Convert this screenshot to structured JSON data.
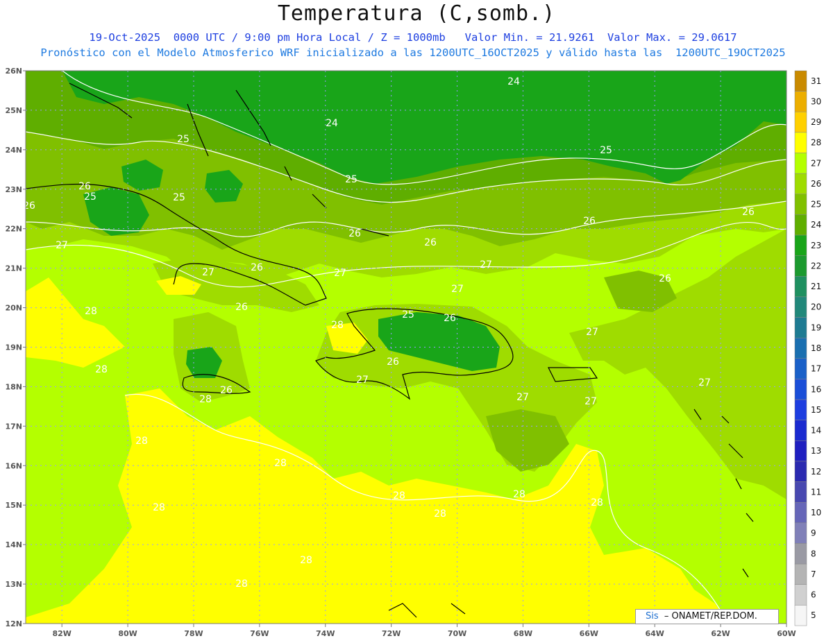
{
  "title": "Temperatura (C,somb.)",
  "subtitle_1": "19-Oct-2025  0000 UTC / 9:00 pm Hora Local / Z = 1000mb   Valor Min. = 21.9261  Valor Max. = 29.0617",
  "subtitle_2": "Pronóstico con el Modelo Atmosferico WRF inicializado a las 1200UTC_16OCT2025 y válido hasta las  1200UTC_19OCT2025",
  "credit": {
    "part1": "Sis",
    "part2": "  – ONAMET/REP.DOM."
  },
  "map": {
    "lon_ticks": [
      "82W",
      "80W",
      "78W",
      "76W",
      "74W",
      "72W",
      "70W",
      "68W",
      "66W",
      "64W",
      "62W",
      "60W"
    ],
    "lat_ticks": [
      "26N",
      "25N",
      "24N",
      "23N",
      "22N",
      "21N",
      "20N",
      "19N",
      "18N",
      "17N",
      "16N",
      "15N",
      "14N",
      "13N",
      "12N"
    ],
    "contour_labels": [
      "24",
      "24",
      "25",
      "25",
      "25",
      "25",
      "25",
      "25",
      "26",
      "26",
      "26",
      "26",
      "26",
      "26",
      "26",
      "26",
      "26",
      "26",
      "26",
      "26",
      "27",
      "27",
      "27",
      "27",
      "27",
      "27",
      "27",
      "27",
      "27",
      "27",
      "28",
      "28",
      "28",
      "28",
      "28",
      "28",
      "28",
      "28",
      "28",
      "28",
      "28",
      "28",
      "28"
    ]
  },
  "colorbar": {
    "levels": [
      "31",
      "30",
      "29",
      "28",
      "27",
      "26",
      "25",
      "24",
      "23",
      "22",
      "21",
      "20",
      "19",
      "18",
      "17",
      "16",
      "15",
      "14",
      "13",
      "12",
      "11",
      "10",
      "9",
      "8",
      "7",
      "6",
      "5"
    ],
    "colors": [
      "#c98a00",
      "#ecae00",
      "#ffd000",
      "#ffff00",
      "#b4ff00",
      "#9fdc00",
      "#80c000",
      "#5fae00",
      "#19a519",
      "#1c9a2f",
      "#1f9060",
      "#21887a",
      "#1e7b92",
      "#1a6fb0",
      "#1a60c8",
      "#1a4ed8",
      "#1d3de0",
      "#1a2ad0",
      "#1f1fc0",
      "#2b2ab0",
      "#4848b0",
      "#6666b8",
      "#8080b8",
      "#9a9aa4",
      "#b4b4b4",
      "#d0d0d0",
      "#f6f6f6"
    ]
  },
  "extent": {
    "lon_min": -83.1,
    "lon_max": -60,
    "lat_min": 12,
    "lat_max": 26
  }
}
